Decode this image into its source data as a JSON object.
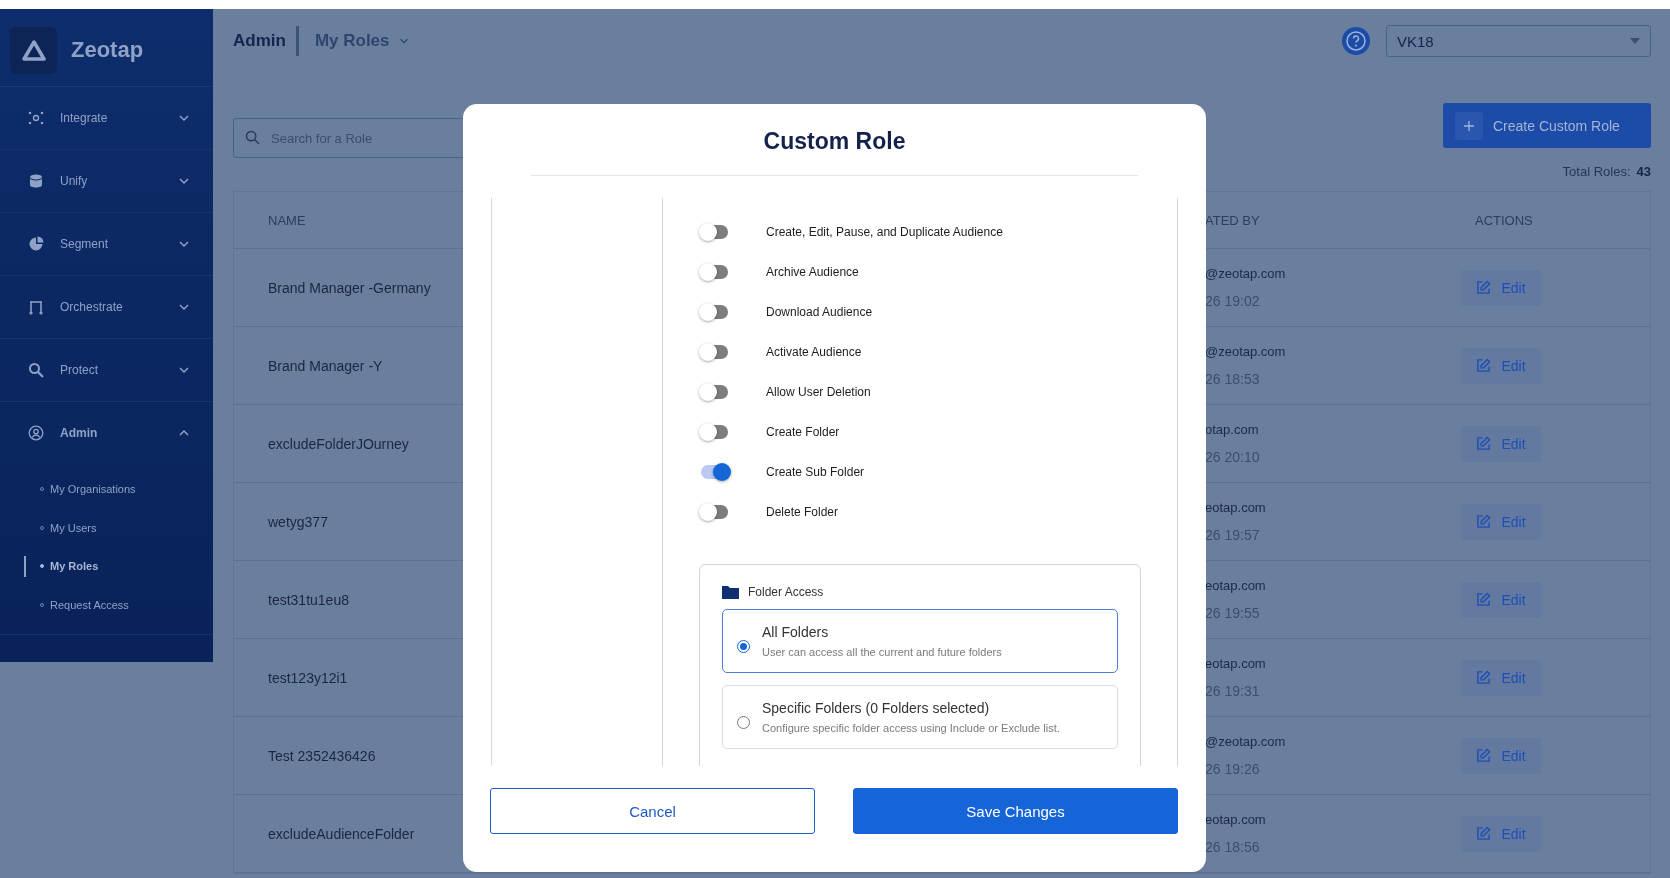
{
  "sidebar": {
    "brand": "Zeotap",
    "items": [
      {
        "label": "Integrate",
        "expanded": false
      },
      {
        "label": "Unify",
        "expanded": false
      },
      {
        "label": "Segment",
        "expanded": false
      },
      {
        "label": "Orchestrate",
        "expanded": false
      },
      {
        "label": "Protect",
        "expanded": false
      },
      {
        "label": "Admin",
        "expanded": true,
        "children": [
          {
            "label": "My Organisations",
            "selected": false
          },
          {
            "label": "My Users",
            "selected": false
          },
          {
            "label": "My Roles",
            "selected": true
          },
          {
            "label": "Request Access",
            "selected": false
          }
        ]
      }
    ]
  },
  "header": {
    "section": "Admin",
    "page": "My Roles",
    "account": "VK18"
  },
  "search": {
    "placeholder": "Search for a Role"
  },
  "create_button": {
    "label": "Create Custom Role"
  },
  "total": {
    "label": "Total Roles:",
    "count": "43"
  },
  "table": {
    "columns": [
      "NAME",
      "ATED BY",
      "ACTIONS"
    ],
    "rows": [
      {
        "name": "Brand Manager -Germany",
        "created_by": "@zeotap.com",
        "created_at": "26 19:02",
        "action": "Edit"
      },
      {
        "name": "Brand Manager -Y",
        "created_by": "@zeotap.com",
        "created_at": "26 18:53",
        "action": "Edit"
      },
      {
        "name": "excludeFolderJOurney",
        "created_by": "otap.com",
        "created_at": "26 20:10",
        "action": "Edit"
      },
      {
        "name": "wetyg377",
        "created_by": "eotap.com",
        "created_at": "26 19:57",
        "action": "Edit"
      },
      {
        "name": "test31tu1eu8",
        "created_by": "eotap.com",
        "created_at": "26 19:55",
        "action": "Edit"
      },
      {
        "name": "test123y12i1",
        "created_by": "eotap.com",
        "created_at": "26 19:31",
        "action": "Edit"
      },
      {
        "name": "Test 2352436426",
        "created_by": "@zeotap.com",
        "created_at": "26 19:26",
        "action": "Edit"
      },
      {
        "name": "excludeAudienceFolder",
        "created_by": "eotap.com",
        "created_at": "26 18:56",
        "action": "Edit"
      }
    ]
  },
  "modal": {
    "title": "Custom Role",
    "permissions": [
      {
        "label": "Create, Edit, Pause, and Duplicate Audience",
        "on": false
      },
      {
        "label": "Archive Audience",
        "on": false
      },
      {
        "label": "Download Audience",
        "on": false
      },
      {
        "label": "Activate Audience",
        "on": false
      },
      {
        "label": "Allow User Deletion",
        "on": false
      },
      {
        "label": "Create Folder",
        "on": false
      },
      {
        "label": "Create Sub Folder",
        "on": true
      },
      {
        "label": "Delete Folder",
        "on": false
      }
    ],
    "folder_access": {
      "title": "Folder Access",
      "options": [
        {
          "title": "All Folders",
          "description": "User can access all the current and future folders",
          "selected": true
        },
        {
          "title": "Specific Folders (0 Folders selected)",
          "description": "Configure specific folder access using Include or Exclude list.",
          "selected": false
        }
      ]
    },
    "cancel": "Cancel",
    "save": "Save Changes"
  }
}
